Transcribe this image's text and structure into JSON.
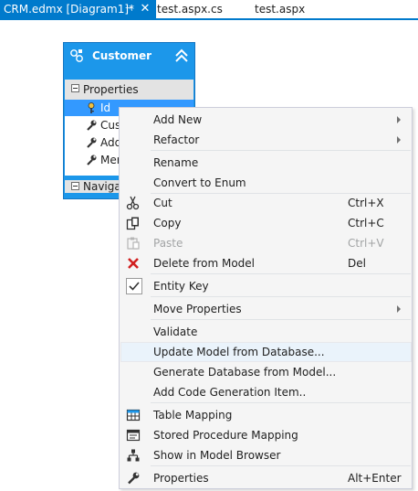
{
  "tabs": [
    {
      "label": "CRM.edmx [Diagram1]*",
      "active": true
    },
    {
      "label": "test.aspx.cs",
      "active": false
    },
    {
      "label": "test.aspx",
      "active": false
    }
  ],
  "tab_glyphs": {
    "pin": "⊣",
    "close": "✕"
  },
  "entity": {
    "title": "Customer",
    "properties_label": "Properties",
    "navigation_label": "Navigat",
    "properties": [
      {
        "label": "Id",
        "icon": "key-icon",
        "selected": true
      },
      {
        "label": "Cust",
        "icon": "wrench-icon",
        "selected": false
      },
      {
        "label": "Add",
        "icon": "wrench-icon",
        "selected": false
      },
      {
        "label": "Mer",
        "icon": "wrench-icon",
        "selected": false
      }
    ]
  },
  "context_menu": {
    "items": [
      {
        "label": "Add New",
        "submenu": true
      },
      {
        "label": "Refactor",
        "submenu": true
      },
      {
        "label": "Rename"
      },
      {
        "label": "Convert to Enum"
      },
      {
        "label": "Cut",
        "shortcut": "Ctrl+X",
        "icon": "scissors-icon"
      },
      {
        "label": "Copy",
        "shortcut": "Ctrl+C",
        "icon": "copy-icon"
      },
      {
        "label": "Paste",
        "shortcut": "Ctrl+V",
        "icon": "paste-icon",
        "disabled": true
      },
      {
        "label": "Delete from Model",
        "shortcut": "Del",
        "icon": "delete-icon"
      },
      {
        "label": "Entity Key",
        "checked": true
      },
      {
        "label": "Move Properties",
        "submenu": true
      },
      {
        "label": "Validate"
      },
      {
        "label": "Update Model from Database...",
        "highlighted": true
      },
      {
        "label": "Generate Database from Model..."
      },
      {
        "label": "Add Code Generation Item.."
      },
      {
        "label": "Table Mapping",
        "icon": "table-mapping-icon"
      },
      {
        "label": "Stored Procedure Mapping",
        "icon": "stored-procedure-icon"
      },
      {
        "label": "Show in Model Browser",
        "icon": "model-browser-icon"
      },
      {
        "label": "Properties",
        "shortcut": "Alt+Enter",
        "icon": "properties-wrench-icon"
      }
    ]
  },
  "colors": {
    "accent": "#007acc",
    "entity_fill": "#1c97ea",
    "selection": "#3399ff",
    "menu_bg": "#f5f5f5",
    "menu_highlight": "#eaf3fb",
    "delete_red": "#d11f1f"
  }
}
